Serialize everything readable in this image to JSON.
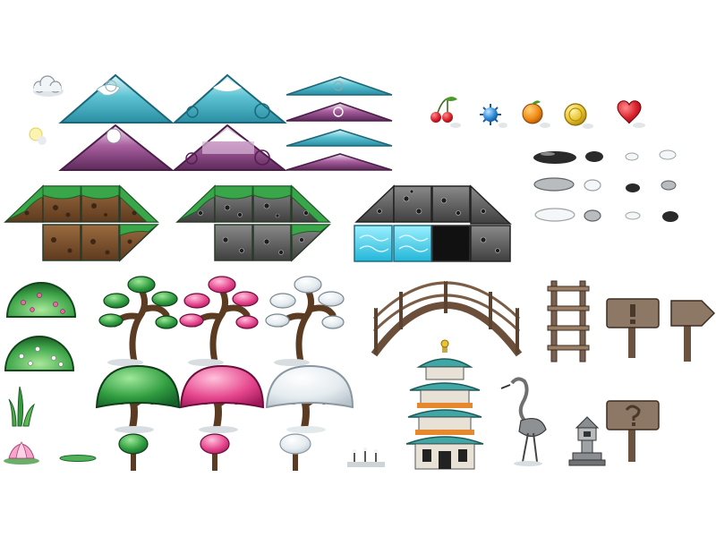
{
  "sheet": {
    "background": "#ffffff",
    "palette": {
      "ice_blue": "#4fb8c9",
      "ice_light": "#bfeaf0",
      "purple": "#7a3a78",
      "purple_light": "#c99ac8",
      "leaf_green": "#3aa64a",
      "leaf_dark": "#1f6b2c",
      "blossom_pink": "#e0508f",
      "snow_white": "#eef2f4",
      "bark_brown": "#6b4a2e",
      "dirt_brown": "#7a4e2c",
      "stone_gray": "#6c6c6c",
      "wood_brown": "#7b6250",
      "cherry_red": "#c3152a",
      "gold": "#e9c531",
      "orange": "#f08a14",
      "teal_roof": "#3fa7a5"
    },
    "sprites": {
      "clouds": [
        "cloud-icon",
        "sun-icon"
      ],
      "mountains": [
        "ice-mountain",
        "ice-mountain-spiral",
        "purple-mountain",
        "purple-mountain-spiral",
        "flat-mountain-ice",
        "flat-mountain-purple"
      ],
      "pickups": [
        "cherries-icon",
        "blue-spiky-orb-icon",
        "orange-fruit-icon",
        "gold-coin-icon",
        "red-heart-icon"
      ],
      "stones": [
        "black-stone",
        "white-stone",
        "silver-stone"
      ],
      "tiles": [
        "dirt-grass-tiles",
        "stone-grass-tiles",
        "stone-ice-tiles"
      ],
      "vegetation": [
        "bush-pink-berries",
        "bush-white-berries",
        "grass-tuft",
        "lotus-flower",
        "lily-pad"
      ],
      "trees": [
        "bonsai-green",
        "bonsai-pink",
        "bonsai-white",
        "mushroom-tree-green",
        "mushroom-tree-pink",
        "mushroom-tree-white",
        "small-tree-green",
        "small-tree-pink",
        "small-tree-white"
      ],
      "structures": [
        "arched-bridge",
        "wooden-ladder",
        "sign-exclamation",
        "sign-arrow-right",
        "sign-question",
        "pagoda",
        "crane-statue",
        "stone-lantern",
        "candle-sticks"
      ]
    }
  }
}
